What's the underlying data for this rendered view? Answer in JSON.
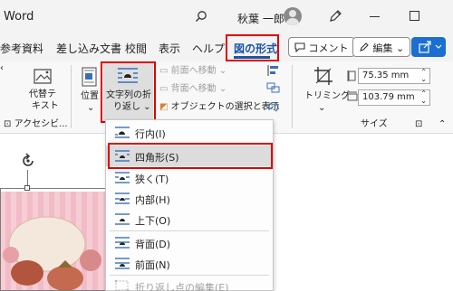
{
  "app": {
    "title": "Word",
    "user_name": "秋葉 一郎"
  },
  "tabs": {
    "items": [
      "参考資料",
      "差し込み文書",
      "校閲",
      "表示",
      "ヘルプ"
    ],
    "active": "図の形式",
    "comment_label": "コメント",
    "edit_label": "編集"
  },
  "ribbon": {
    "alt_text_line1": "代替テ",
    "alt_text_line2": "キスト",
    "accessibility_group": "アクセシビ...",
    "position_label": "位置",
    "wrap_text_line1": "文字列の折",
    "wrap_text_line2": "り返し",
    "bring_forward": "前面へ移動",
    "send_backward": "背面へ移動",
    "selection_pane": "オブジェクトの選択と表示",
    "trim_label": "トリミング",
    "height_value": "75.35 mm",
    "width_value": "103.79 mm",
    "size_group": "サイズ"
  },
  "menu": {
    "items": [
      {
        "label": "行内(I)",
        "state": "normal"
      },
      {
        "label": "四角形(S)",
        "state": "selected"
      },
      {
        "label": "狭く(T)",
        "state": "normal"
      },
      {
        "label": "内部(H)",
        "state": "normal"
      },
      {
        "label": "上下(O)",
        "state": "normal"
      },
      {
        "label": "背面(D)",
        "state": "normal"
      },
      {
        "label": "前面(N)",
        "state": "normal"
      },
      {
        "label": "折り返し点の編集(E)",
        "state": "disabled"
      }
    ]
  },
  "colors": {
    "highlight": "#e00000",
    "accent": "#1a55a6",
    "share": "#1a6fd0"
  }
}
